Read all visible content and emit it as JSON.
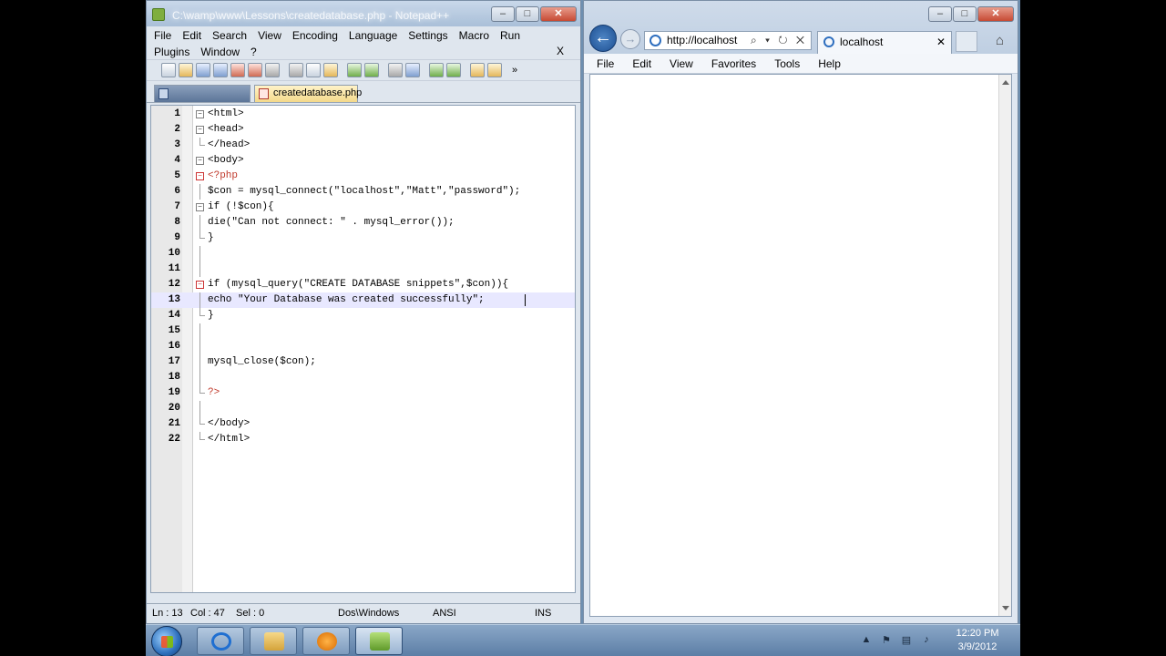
{
  "notepad": {
    "title": "C:\\wamp\\www\\Lessons\\createdatabase.php - Notepad++",
    "menu": [
      "File",
      "Edit",
      "Search",
      "View",
      "Encoding",
      "Language",
      "Settings",
      "Macro",
      "Run",
      "Plugins",
      "Window",
      "?"
    ],
    "menu_close": "X",
    "toolbar_more": "»",
    "tabs": [
      {
        "label": "",
        "active": false
      },
      {
        "label": "createdatabase.php",
        "active": true
      }
    ],
    "lines": [
      {
        "num": "1",
        "text": "<html>"
      },
      {
        "num": "2",
        "text": "<head>"
      },
      {
        "num": "3",
        "text": "</head>"
      },
      {
        "num": "4",
        "text": "<body>"
      },
      {
        "num": "5",
        "text": "<?php"
      },
      {
        "num": "6",
        "text": "$con = mysql_connect(\"localhost\",\"Matt\",\"password\");"
      },
      {
        "num": "7",
        "text": "if (!$con){"
      },
      {
        "num": "8",
        "text": "die(\"Can not connect: \" . mysql_error());"
      },
      {
        "num": "9",
        "text": "}"
      },
      {
        "num": "10",
        "text": ""
      },
      {
        "num": "11",
        "text": ""
      },
      {
        "num": "12",
        "text": "if (mysql_query(\"CREATE DATABASE snippets\",$con)){"
      },
      {
        "num": "13",
        "text": "echo \"Your Database was created successfully\";"
      },
      {
        "num": "14",
        "text": "}"
      },
      {
        "num": "15",
        "text": ""
      },
      {
        "num": "16",
        "text": ""
      },
      {
        "num": "17",
        "text": "mysql_close($con);"
      },
      {
        "num": "18",
        "text": ""
      },
      {
        "num": "19",
        "text": "?>"
      },
      {
        "num": "20",
        "text": ""
      },
      {
        "num": "21",
        "text": "</body>"
      },
      {
        "num": "22",
        "text": "</html>"
      }
    ],
    "status": {
      "line": "Ln : 13",
      "col": "Col : 47",
      "sel": "Sel : 0",
      "eol": "Dos\\Windows",
      "encoding": "ANSI",
      "mode": "INS"
    }
  },
  "browser": {
    "address": "http://localhost",
    "address_tools": "⌕ ▾ ↻ ✕",
    "tab_title": "localhost",
    "tab_close": "✕",
    "menu": [
      "File",
      "Edit",
      "View",
      "Favorites",
      "Tools",
      "Help"
    ]
  },
  "taskbar": {
    "time": "12:20 PM",
    "date": "3/9/2012"
  }
}
